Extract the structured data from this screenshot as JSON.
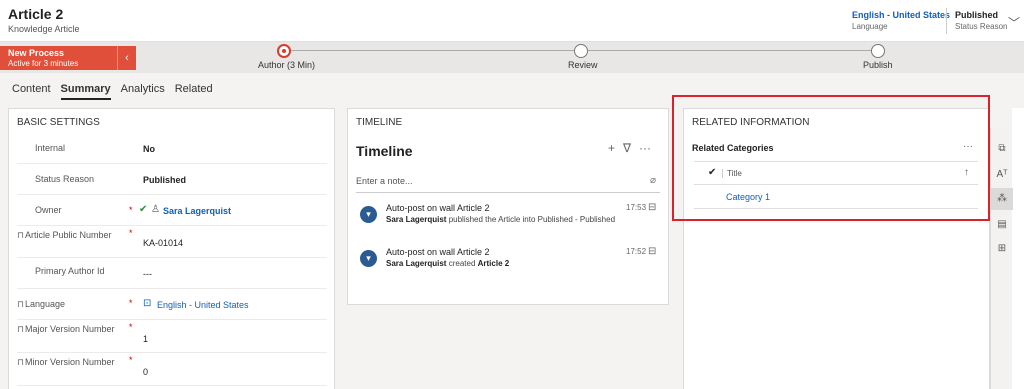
{
  "header": {
    "title": "Article 2",
    "subtitle": "Knowledge Article",
    "language_value": "English - United States",
    "language_label": "Language",
    "status_value": "Published",
    "status_label": "Status Reason"
  },
  "process": {
    "name": "New Process",
    "active": "Active for 3 minutes",
    "stages": [
      "Author (3 Min)",
      "Review",
      "Publish"
    ]
  },
  "tabs": [
    "Content",
    "Summary",
    "Analytics",
    "Related"
  ],
  "basic": {
    "heading": "BASIC SETTINGS",
    "fields": [
      {
        "label": "Internal",
        "value": "No"
      },
      {
        "label": "Status Reason",
        "value": "Published"
      },
      {
        "label": "Owner",
        "value": "Sara Lagerquist"
      },
      {
        "label": "Article Public Number",
        "value": "KA-01014"
      },
      {
        "label": "Primary Author Id",
        "value": "---"
      },
      {
        "label": "Language",
        "value": "English - United States"
      },
      {
        "label": "Major Version Number",
        "value": "1"
      },
      {
        "label": "Minor Version Number",
        "value": "0"
      }
    ]
  },
  "timeline": {
    "heading": "TIMELINE",
    "title": "Timeline",
    "note_placeholder": "Enter a note...",
    "posts": [
      {
        "title": "Auto-post on wall Article 2",
        "user": "Sara Lagerquist",
        "action": "published the Article into Published - Published",
        "time": "17:53"
      },
      {
        "title": "Auto-post on wall Article 2",
        "user": "Sara Lagerquist",
        "action": "created",
        "object": "Article 2",
        "time": "17:52"
      }
    ]
  },
  "related": {
    "heading": "RELATED INFORMATION",
    "subheading": "Related Categories",
    "column": "Title",
    "items": [
      "Category 1"
    ]
  },
  "colors": {
    "accent": "#1160b7",
    "process": "#e04f3a",
    "highlight": "#d9232c"
  }
}
